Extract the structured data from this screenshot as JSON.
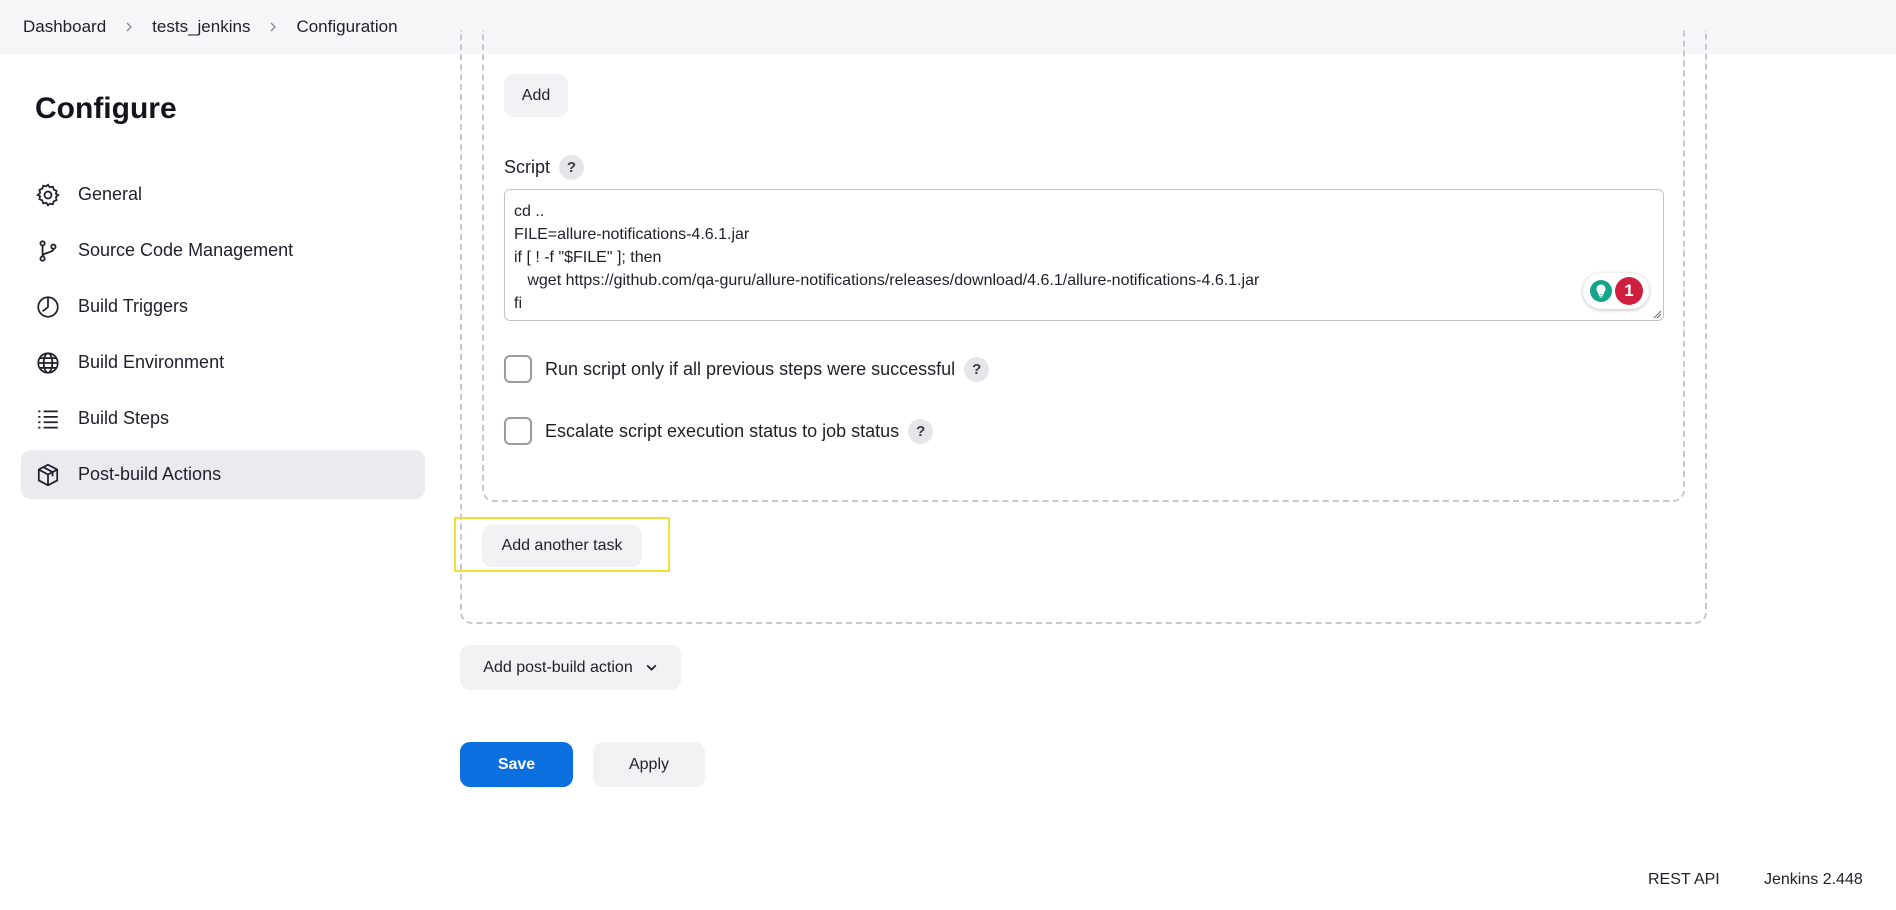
{
  "breadcrumb": {
    "items": [
      "Dashboard",
      "tests_jenkins",
      "Configuration"
    ]
  },
  "page": {
    "title": "Configure"
  },
  "sidebar": {
    "items": [
      {
        "label": "General",
        "icon": "gear-icon"
      },
      {
        "label": "Source Code Management",
        "icon": "git-branch-icon"
      },
      {
        "label": "Build Triggers",
        "icon": "timer-icon"
      },
      {
        "label": "Build Environment",
        "icon": "globe-icon"
      },
      {
        "label": "Build Steps",
        "icon": "list-icon"
      },
      {
        "label": "Post-build Actions",
        "icon": "cube-icon",
        "active": true
      }
    ]
  },
  "task": {
    "add_label": "Add",
    "script_label": "Script",
    "help_label": "?",
    "script_value": "cd ..\nFILE=allure-notifications-4.6.1.jar\nif [ ! -f \"$FILE\" ]; then\n   wget https://github.com/qa-guru/allure-notifications/releases/download/4.6.1/allure-notifications-4.6.1.jar\nfi",
    "grammar_count": "1",
    "run_only_if_success_label": "Run script only if all previous steps were successful",
    "escalate_label": "Escalate script execution status to job status"
  },
  "actions": {
    "add_another_task": "Add another task",
    "add_post_build_action": "Add post-build action",
    "save": "Save",
    "apply": "Apply"
  },
  "footer": {
    "rest_api": "REST API",
    "version": "Jenkins 2.448"
  },
  "colors": {
    "primary": "#0b6fe0",
    "highlight": "#f0e234",
    "badge": "#cf1f3e"
  }
}
